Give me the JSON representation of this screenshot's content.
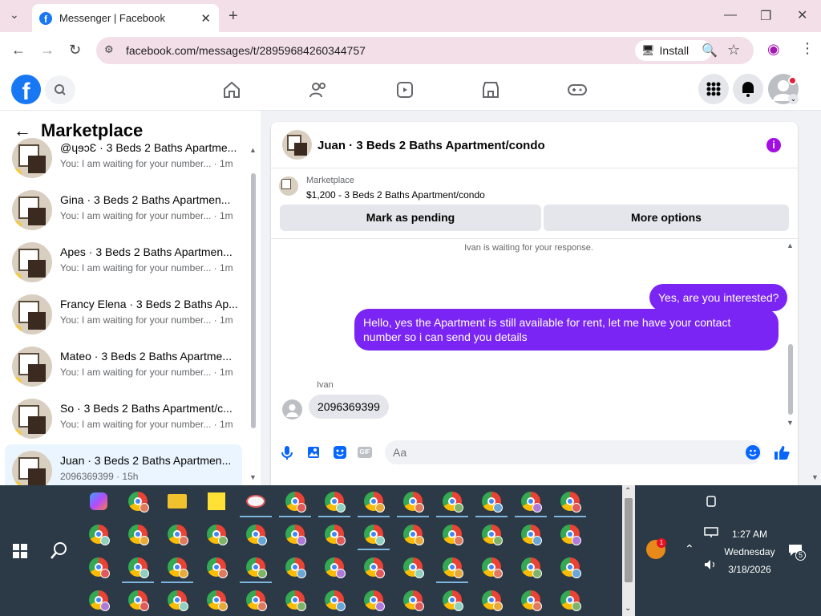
{
  "browser": {
    "tab_title": "Messenger | Facebook",
    "url": "facebook.com/messages/t/28959684260344757",
    "install_label": "Install"
  },
  "sidebar": {
    "title": "Marketplace",
    "conversations": [
      {
        "name": "@ɥɘɔƐ · 3 Beds 2 Baths Apartme...",
        "preview": "You: I am waiting for your number... · 1m"
      },
      {
        "name": "Gina · 3 Beds 2 Baths Apartmen...",
        "preview": "You: I am waiting for your number... · 1m"
      },
      {
        "name": "Apes · 3 Beds 2 Baths Apartmen...",
        "preview": "You: I am waiting for your number... · 1m"
      },
      {
        "name": "Francy Elena · 3 Beds 2 Baths Ap...",
        "preview": "You: I am waiting for your number... · 1m"
      },
      {
        "name": "Mateo · 3 Beds 2 Baths Apartme...",
        "preview": "You: I am waiting for your number... · 1m"
      },
      {
        "name": "So · 3 Beds 2 Baths Apartment/c...",
        "preview": "You: I am waiting for your number... · 1m"
      },
      {
        "name": "Juan · 3 Beds 2 Baths Apartmen...",
        "preview": "2096369399 · 15h"
      }
    ]
  },
  "chat": {
    "title": "Juan · 3 Beds 2 Baths Apartment/condo",
    "listing_source": "Marketplace",
    "listing": "$1,200 - 3 Beds 2 Baths Apartment/condo",
    "mark_pending": "Mark as pending",
    "more_options": "More options",
    "waiting_notice": "Ivan is waiting for your response.",
    "messages": [
      {
        "from": "me",
        "text": "Yes, are you interested?"
      },
      {
        "from": "me",
        "text": "Hello, yes the Apartment is still available for rent, let me have your contact number so i can send you details"
      },
      {
        "from": "Ivan",
        "text": "2096369399"
      }
    ],
    "input_placeholder": "Aa"
  },
  "taskbar": {
    "time": "1:27 AM",
    "day": "Wednesday",
    "date": "3/18/2026",
    "notification_count": "5",
    "weather_badge": "1"
  },
  "colors": {
    "facebook_blue": "#1877f2",
    "outgoing_bubble": "#7b25f5",
    "info_icon": "#a20ee4"
  }
}
